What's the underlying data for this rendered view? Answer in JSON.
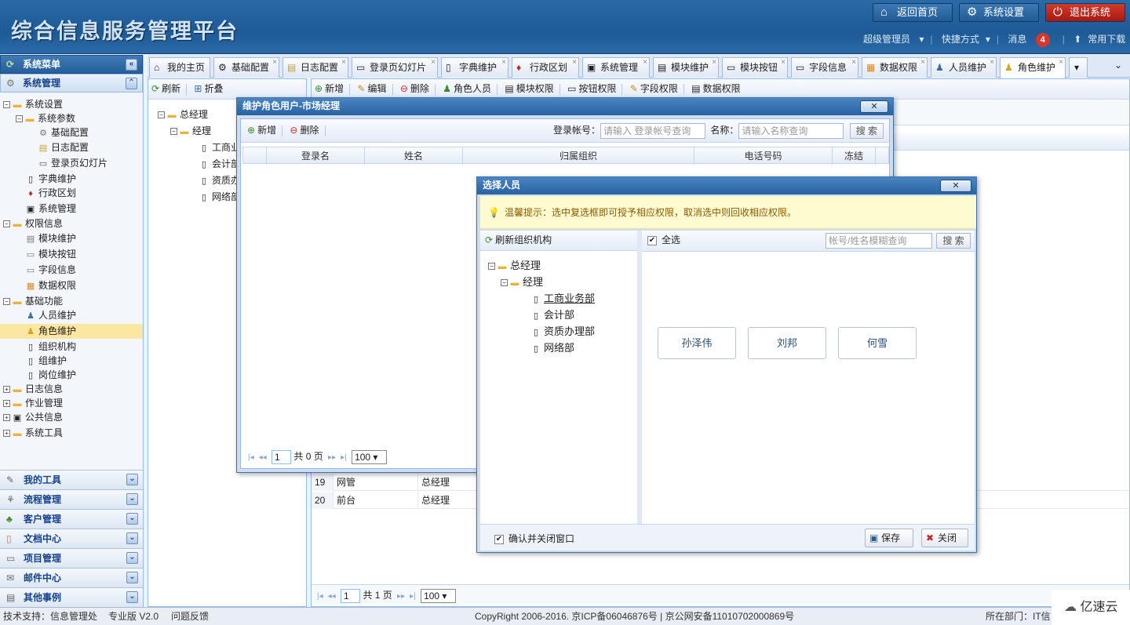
{
  "header": {
    "title": "综合信息服务管理平台",
    "home_label": "返回首页",
    "settings_label": "系统设置",
    "exit_label": "退出系统",
    "user_label": "超级管理员",
    "shortcut_label": "快捷方式",
    "message_label": "消息",
    "message_count": "4",
    "download_label": "常用下载"
  },
  "sidebar": {
    "menu_title": "系统菜单",
    "section_title": "系统管理",
    "tree": [
      {
        "label": "系统设置"
      },
      {
        "label": "系统参数"
      },
      {
        "label": "基础配置"
      },
      {
        "label": "日志配置"
      },
      {
        "label": "登录页幻灯片"
      },
      {
        "label": "字典维护"
      },
      {
        "label": "行政区划"
      },
      {
        "label": "系统管理"
      },
      {
        "label": "权限信息"
      },
      {
        "label": "模块维护"
      },
      {
        "label": "模块按钮"
      },
      {
        "label": "字段信息"
      },
      {
        "label": "数据权限"
      },
      {
        "label": "基础功能"
      },
      {
        "label": "人员维护"
      },
      {
        "label": "角色维护"
      },
      {
        "label": "组织机构"
      },
      {
        "label": "组维护"
      },
      {
        "label": "岗位维护"
      },
      {
        "label": "日志信息"
      },
      {
        "label": "作业管理"
      },
      {
        "label": "公共信息"
      },
      {
        "label": "系统工具"
      }
    ],
    "accordion": [
      "我的工具",
      "流程管理",
      "客户管理",
      "文档中心",
      "项目管理",
      "邮件中心",
      "其他事例"
    ]
  },
  "tabs": [
    "我的主页",
    "基础配置",
    "日志配置",
    "登录页幻灯片",
    "字典维护",
    "行政区划",
    "系统管理",
    "模块维护",
    "模块按钮",
    "字段信息",
    "数据权限",
    "人员维护",
    "角色维护"
  ],
  "left_panel": {
    "refresh": "刷新",
    "fold": "折叠",
    "tree": [
      "总经理",
      "经理",
      "工商业务部",
      "会计部",
      "资质办理部",
      "网络部"
    ]
  },
  "main_toolbar": [
    "新增",
    "编辑",
    "删除",
    "角色人员",
    "模块权限",
    "按钮权限",
    "字段权限",
    "数据权限"
  ],
  "main_grid": {
    "rows": [
      {
        "num": "19",
        "name": "网管",
        "org": "总经理"
      },
      {
        "num": "20",
        "name": "前台",
        "org": "总经理"
      }
    ],
    "pager": {
      "page": "1",
      "total": "共 1 页",
      "size": "100"
    }
  },
  "dialog_role_users": {
    "title": "维护角色用户-市场经理",
    "add": "新增",
    "delete": "删除",
    "account_label": "登录帐号：",
    "account_placeholder": "请输入 登录帐号查询",
    "name_label": "名称：",
    "name_placeholder": "请输入名称查询",
    "search": "搜 索",
    "columns": [
      "登录名",
      "姓名",
      "归属组织",
      "电话号码",
      "冻结"
    ],
    "pager": {
      "page": "1",
      "total": "共 0 页",
      "size": "100"
    }
  },
  "dialog_select": {
    "title": "选择人员",
    "tip": "温馨提示：选中复选框即可授予相应权限，取消选中则回收相应权限。",
    "refresh_org": "刷新组织机构",
    "select_all": "全选",
    "search_placeholder": "帐号/姓名模糊查询",
    "search": "搜 索",
    "tree": [
      "总经理",
      "经理",
      "工商业务部",
      "会计部",
      "资质办理部",
      "网络部"
    ],
    "persons": [
      "孙泽伟",
      "刘邦",
      "何雪"
    ],
    "confirm_close": "确认并关闭窗口",
    "save": "保存",
    "close": "关闭"
  },
  "statusbar": {
    "support": "技术支持：信息管理处",
    "version": "专业版 V2.0",
    "feedback": "问题反馈",
    "copyright": "CopyRight 2006-2016. 京ICP备06046876号 | 京公网安备11010702000869号",
    "dept": "所在部门：IT信",
    "watermark": "亿速云"
  }
}
